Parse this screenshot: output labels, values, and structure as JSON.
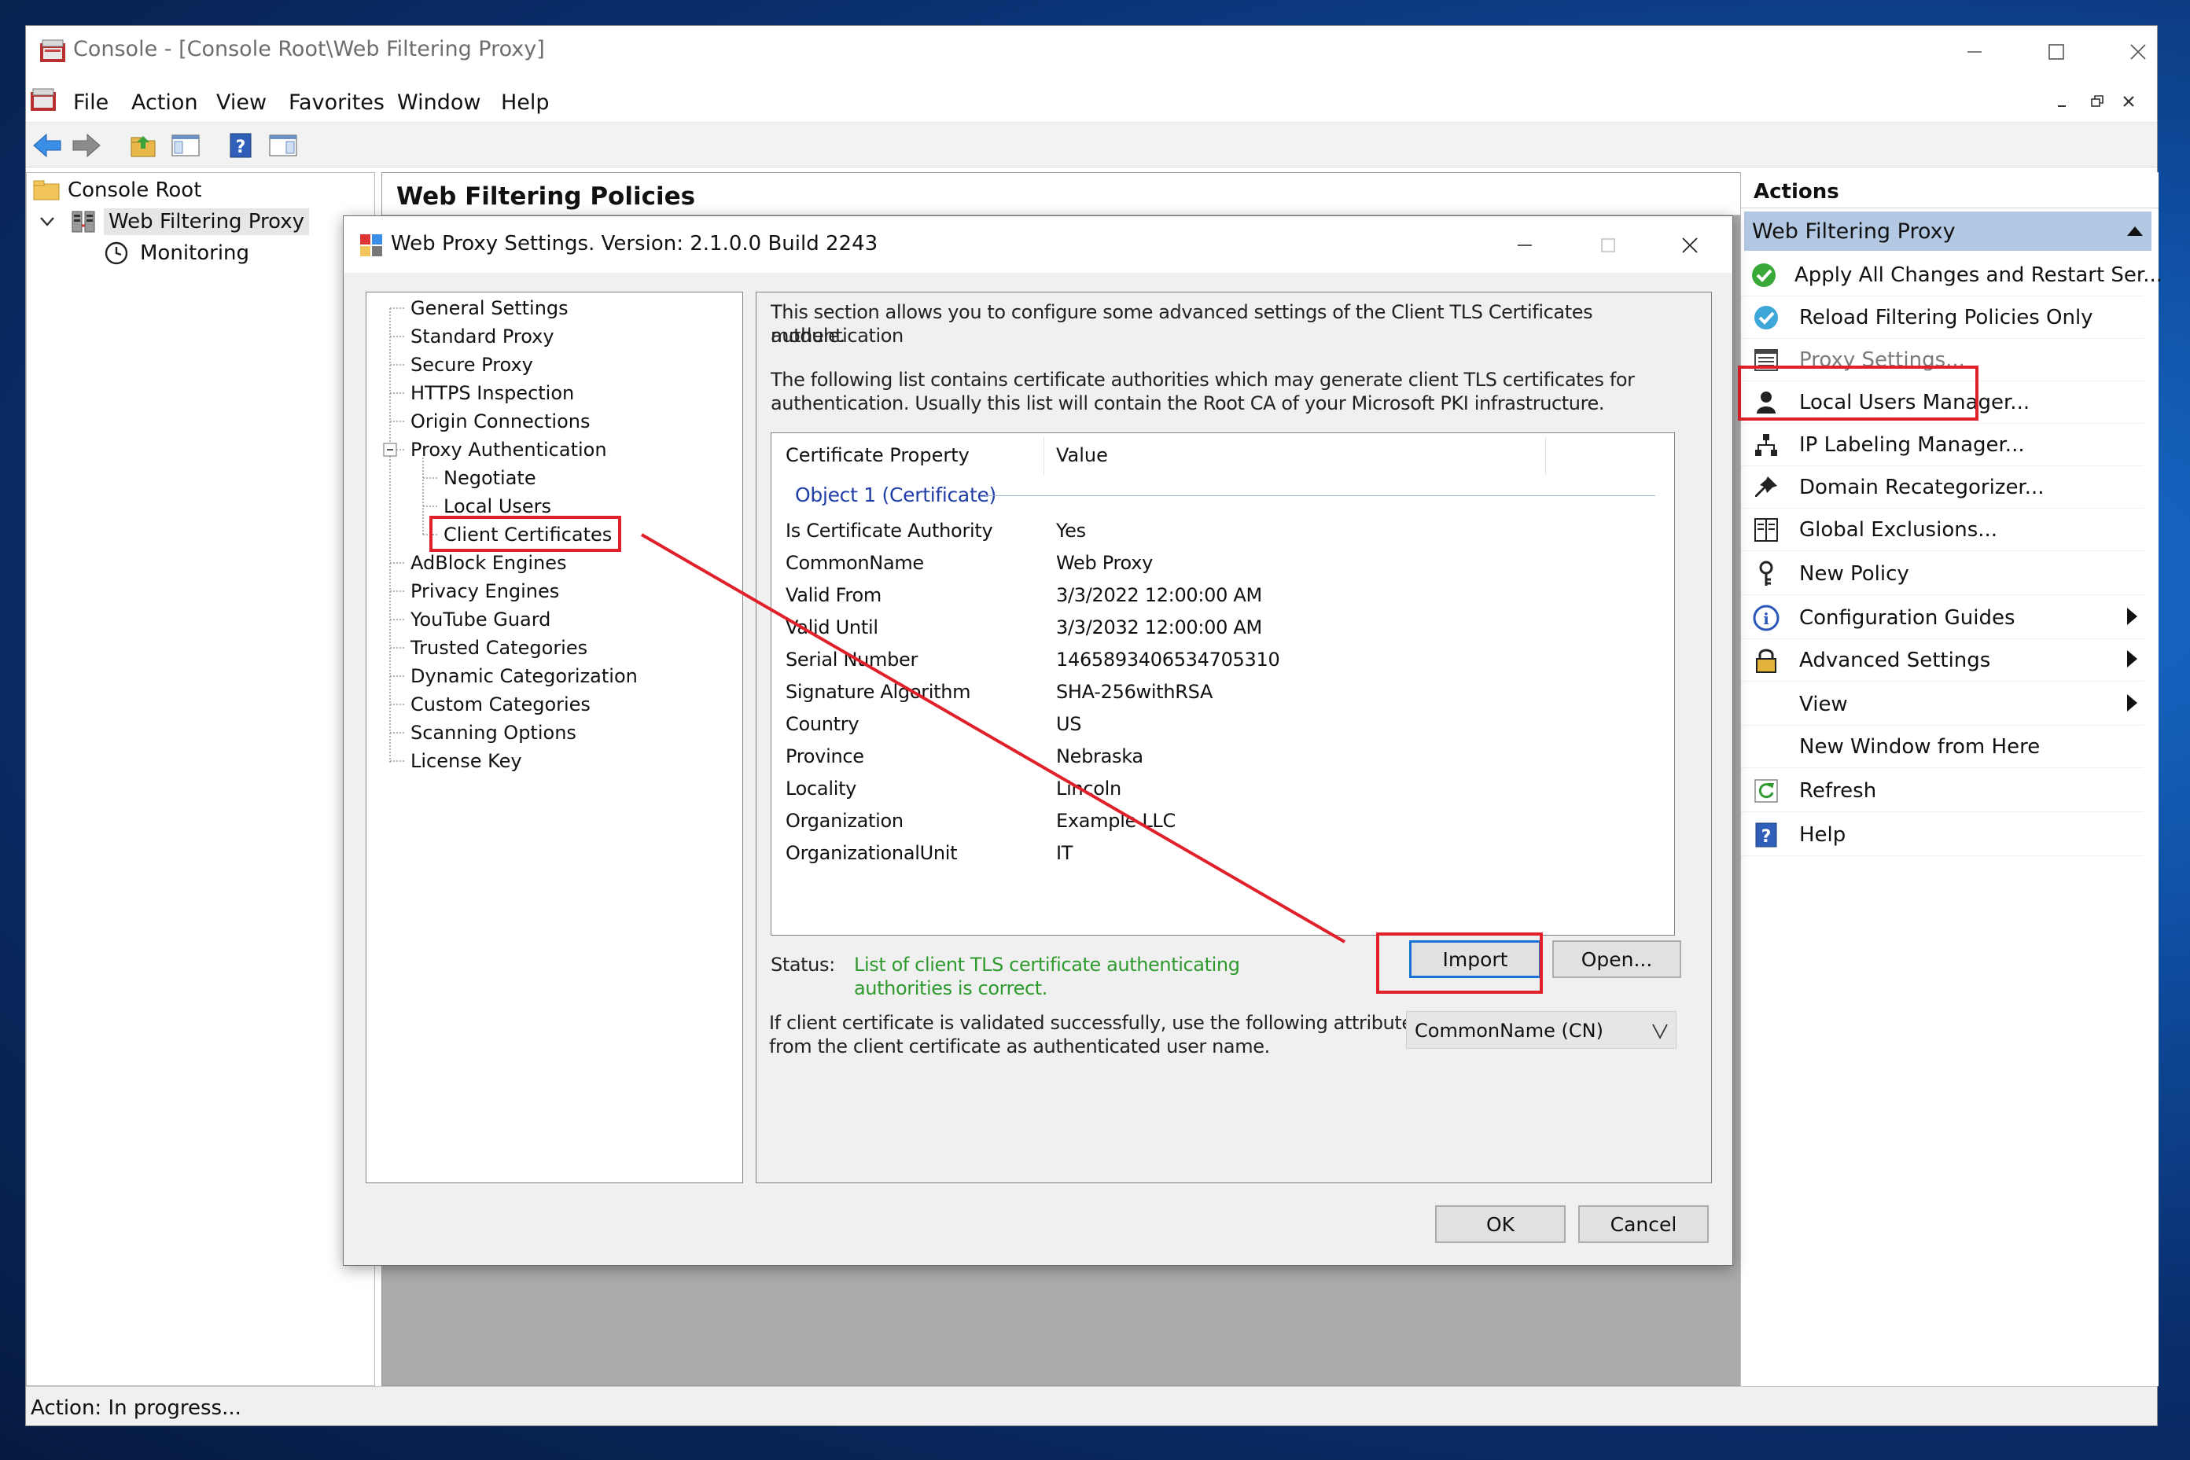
{
  "window": {
    "title": "Console - [Console Root\\Web Filtering Proxy]",
    "menu": [
      "File",
      "Action",
      "View",
      "Favorites",
      "Window",
      "Help"
    ]
  },
  "tree": {
    "items": [
      {
        "label": "Console Root",
        "icon": "folder-icon"
      },
      {
        "label": "Web Filtering Proxy",
        "icon": "proxy-server-icon"
      },
      {
        "label": "Monitoring",
        "icon": "clock-icon"
      }
    ]
  },
  "center": {
    "heading": "Web Filtering Policies"
  },
  "actions": {
    "header": "Actions",
    "section": "Web Filtering Proxy",
    "items": [
      {
        "label": "Apply All Changes and Restart Ser...",
        "icon": "check-circle-icon",
        "submenu": false
      },
      {
        "label": "Reload Filtering Policies Only",
        "icon": "check-circle-blue-icon",
        "submenu": false
      },
      {
        "label": "Proxy Settings...",
        "icon": "settings-form-icon",
        "submenu": false
      },
      {
        "label": "Local Users Manager...",
        "icon": "user-icon",
        "submenu": false
      },
      {
        "label": "IP Labeling Manager...",
        "icon": "network-icon",
        "submenu": false
      },
      {
        "label": "Domain Recategorizer...",
        "icon": "pin-icon",
        "submenu": false
      },
      {
        "label": "Global Exclusions...",
        "icon": "list-icon",
        "submenu": false
      },
      {
        "label": "New Policy",
        "icon": "key-icon",
        "submenu": false
      },
      {
        "label": "Configuration Guides",
        "icon": "info-icon",
        "submenu": true
      },
      {
        "label": "Advanced Settings",
        "icon": "lock-icon",
        "submenu": true
      },
      {
        "label": "View",
        "icon": "",
        "submenu": true
      },
      {
        "label": "New Window from Here",
        "icon": "",
        "submenu": false
      },
      {
        "label": "Refresh",
        "icon": "refresh-icon",
        "submenu": false
      },
      {
        "label": "Help",
        "icon": "help-icon",
        "submenu": false
      }
    ]
  },
  "status_bar": "Action:  In progress...",
  "dialog": {
    "title": "Web Proxy Settings. Version: 2.1.0.0 Build 2243",
    "nav": [
      "General Settings",
      "Standard Proxy",
      "Secure Proxy",
      "HTTPS Inspection",
      "Origin Connections",
      "Proxy Authentication",
      "Negotiate",
      "Local Users",
      "Client Certificates",
      "AdBlock Engines",
      "Privacy Engines",
      "YouTube Guard",
      "Trusted Categories",
      "Dynamic Categorization",
      "Custom Categories",
      "Scanning Options",
      "License Key"
    ],
    "selected_nav": "Client Certificates",
    "desc1_line1": "This section allows you to configure some advanced settings of the Client TLS Certificates authentication",
    "desc1_line2": "module.",
    "desc2_line1": "The following list contains certificate authorities which may generate client TLS certificates for",
    "desc2_line2": "authentication. Usually this list will contain the Root CA of your Microsoft PKI infrastructure.",
    "list": {
      "col_property": "Certificate Property",
      "col_value": "Value",
      "group": "Object 1 (Certificate)",
      "rows": [
        {
          "prop": "Is Certificate Authority",
          "value": "Yes"
        },
        {
          "prop": "CommonName",
          "value": "Web Proxy"
        },
        {
          "prop": "Valid From",
          "value": "3/3/2022 12:00:00 AM"
        },
        {
          "prop": "Valid Until",
          "value": "3/3/2032 12:00:00 AM"
        },
        {
          "prop": "Serial Number",
          "value": "1465893406534705310"
        },
        {
          "prop": "Signature Algorithm",
          "value": "SHA-256withRSA"
        },
        {
          "prop": "Country",
          "value": "US"
        },
        {
          "prop": "Province",
          "value": "Nebraska"
        },
        {
          "prop": "Locality",
          "value": "Lincoln"
        },
        {
          "prop": "Organization",
          "value": "Example LLC"
        },
        {
          "prop": "OrganizationalUnit",
          "value": "IT"
        }
      ]
    },
    "status_label": "Status:",
    "status_line1": "List of client TLS certificate authenticating",
    "status_line2": "authorities is correct.",
    "import_label": "Import",
    "open_label": "Open...",
    "attr_line1": "If client certificate is validated successfully, use the following attribute",
    "attr_line2": "from the client certificate as authenticated user name.",
    "attr_select": "CommonName (CN)",
    "ok_label": "OK",
    "cancel_label": "Cancel"
  },
  "colors": {
    "status_green": "#2e9a2e",
    "group_blue": "#1f3fa6",
    "annotation_red": "#e0202a",
    "actions_header_bg": "#b3c9e3"
  }
}
